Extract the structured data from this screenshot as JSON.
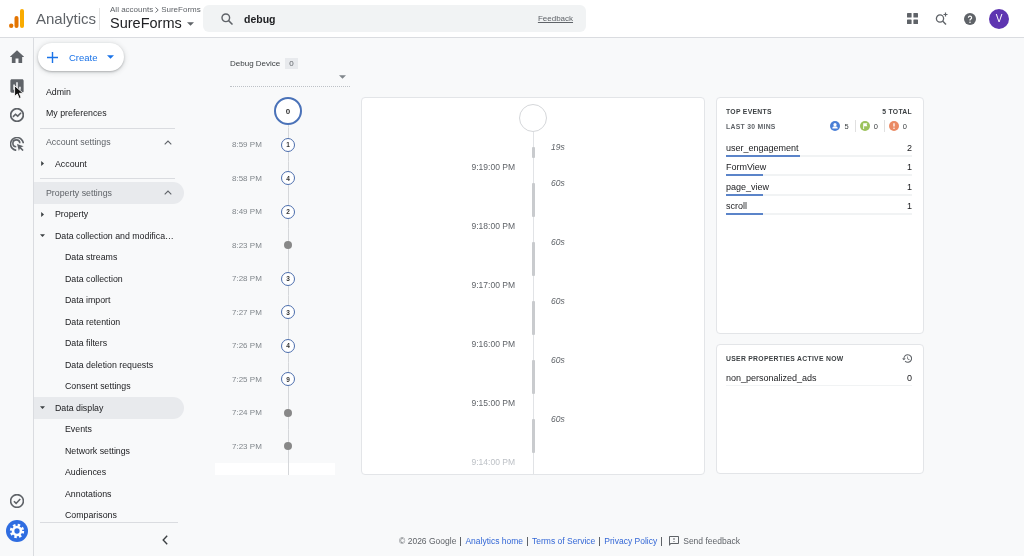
{
  "topbar": {
    "product": "Analytics",
    "breadcrumb": [
      "All accounts",
      "SureForms"
    ],
    "property": "SureForms",
    "search": {
      "value": "debug",
      "feedback": "Feedback"
    },
    "account": {
      "initial": "V"
    }
  },
  "nav_rail": {
    "items": [
      {
        "selected": false
      },
      {
        "selected": false
      },
      {
        "selected": false
      },
      {
        "selected": false
      }
    ],
    "bottom_items": [
      {
        "selected": false
      },
      {
        "selected": true
      }
    ]
  },
  "sidebar": {
    "create_button": "Create",
    "items": [
      {
        "label": "Admin",
        "selected": false
      },
      {
        "label": "My preferences",
        "selected": false
      }
    ],
    "sections": [
      {
        "title": "Account settings",
        "expanded": true,
        "highlighted": false,
        "items": [
          {
            "label": "Account",
            "expanded": false,
            "selected": false
          }
        ]
      },
      {
        "title": "Property settings",
        "expanded": true,
        "highlighted": true,
        "items": [
          {
            "label": "Property",
            "expanded": false,
            "selected": false
          },
          {
            "label": "Data collection and modifica…",
            "expanded": true,
            "selected": false,
            "children": [
              {
                "label": "Data streams",
                "selected": false
              },
              {
                "label": "Data collection",
                "selected": false
              },
              {
                "label": "Data import",
                "selected": false
              },
              {
                "label": "Data retention",
                "selected": false
              },
              {
                "label": "Data filters",
                "selected": false
              },
              {
                "label": "Data deletion requests",
                "selected": false
              },
              {
                "label": "Consent settings",
                "selected": false
              }
            ]
          },
          {
            "label": "Data display",
            "expanded": true,
            "selected": true,
            "children": [
              {
                "label": "Events",
                "selected": false
              },
              {
                "label": "Network settings",
                "selected": false
              },
              {
                "label": "Audiences",
                "selected": false
              },
              {
                "label": "Annotations",
                "selected": false
              },
              {
                "label": "Comparisons",
                "selected": false
              }
            ]
          }
        ]
      }
    ]
  },
  "debug_device": {
    "label": "Debug Device",
    "count": "0"
  },
  "minutes": {
    "current": "0",
    "rows": [
      {
        "time": "8:59 PM",
        "kind": "events",
        "count": "1"
      },
      {
        "time": "8:58 PM",
        "kind": "events",
        "count": "4"
      },
      {
        "time": "8:49 PM",
        "kind": "events",
        "count": "2"
      },
      {
        "time": "8:23 PM",
        "kind": "empty"
      },
      {
        "time": "7:28 PM",
        "kind": "events",
        "count": "3"
      },
      {
        "time": "7:27 PM",
        "kind": "events",
        "count": "3"
      },
      {
        "time": "7:26 PM",
        "kind": "events",
        "count": "4"
      },
      {
        "time": "7:25 PM",
        "kind": "events",
        "count": "9"
      },
      {
        "time": "7:24 PM",
        "kind": "empty"
      },
      {
        "time": "7:23 PM",
        "kind": "empty"
      }
    ]
  },
  "seconds_stream": [
    {
      "duration": "19s",
      "level": 0.32,
      "time": "9:19:00 PM"
    },
    {
      "duration": "60s",
      "level": 1,
      "time": "9:18:00 PM"
    },
    {
      "duration": "60s",
      "level": 1,
      "time": "9:17:00 PM"
    },
    {
      "duration": "60s",
      "level": 1,
      "time": "9:16:00 PM"
    },
    {
      "duration": "60s",
      "level": 1,
      "time": "9:15:00 PM"
    },
    {
      "duration": "60s",
      "level": 1,
      "time": "9:14:00 PM"
    }
  ],
  "top_events": {
    "title": "TOP EVENTS",
    "total": "5 TOTAL",
    "period": "LAST 30 MINS",
    "counters": [
      {
        "count": "5",
        "color": "#4a7fd6"
      },
      {
        "count": "0",
        "color": "#9bc25b"
      },
      {
        "count": "0",
        "color": "#ea8a64"
      }
    ],
    "events": [
      {
        "name": "user_engagement",
        "count": "2",
        "level": 0.4
      },
      {
        "name": "FormView",
        "count": "1",
        "level": 0.2
      },
      {
        "name": "page_view",
        "count": "1",
        "level": 0.2
      },
      {
        "name": "scroll",
        "count": "1",
        "level": 0.2
      }
    ]
  },
  "user_properties": {
    "title": "USER PROPERTIES ACTIVE NOW",
    "items": [
      {
        "name": "non_personalized_ads",
        "count": "0"
      }
    ]
  },
  "footer": {
    "copyright": "© 2026 Google",
    "links": [
      "Analytics home",
      "Terms of Service",
      "Privacy Policy"
    ],
    "feedback": "Send feedback"
  }
}
